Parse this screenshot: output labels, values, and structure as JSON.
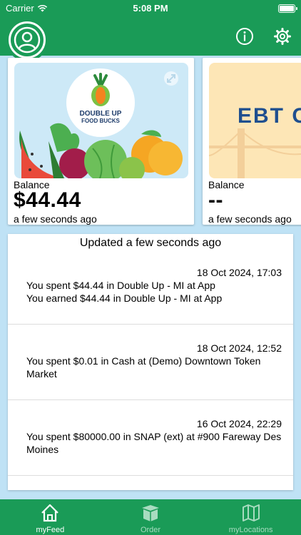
{
  "status_bar": {
    "carrier": "Carrier",
    "time": "5:08 PM"
  },
  "nav": {
    "profile_icon": "person-circle-icon",
    "info_icon": "info-icon",
    "settings_icon": "gear-icon"
  },
  "cards": [
    {
      "logo_line1": "DOUBLE UP",
      "logo_line2": "FOOD BUCKS",
      "balance_label": "Balance",
      "balance_value": "$44.44",
      "updated": "a few seconds ago"
    },
    {
      "logo_text": "EBT C",
      "balance_label": "Balance",
      "balance_value": "--",
      "updated": "a few seconds ago"
    }
  ],
  "feed": {
    "updated_text": "Updated a few seconds ago",
    "entries": [
      {
        "date": "18 Oct 2024, 17:03",
        "line1": "You spent $44.44 in Double Up - MI at App",
        "line2": "You earned $44.44 in Double Up - MI at App"
      },
      {
        "date": "18 Oct 2024, 12:52",
        "line1": "You spent $0.01 in Cash at (Demo) Downtown Token Market"
      },
      {
        "date": "16 Oct 2024, 22:29",
        "line1": "You spent $80000.00 in SNAP (ext) at #900 Fareway Des Moines"
      }
    ]
  },
  "tabs": [
    {
      "label": "myFeed",
      "icon": "home-icon",
      "active": true
    },
    {
      "label": "Order",
      "icon": "box-icon",
      "active": false
    },
    {
      "label": "myLocations",
      "icon": "map-icon",
      "active": false
    }
  ],
  "colors": {
    "brand_green": "#1a9b57",
    "background": "#bfe2f5",
    "tab_inactive": "#a8dcc0"
  }
}
